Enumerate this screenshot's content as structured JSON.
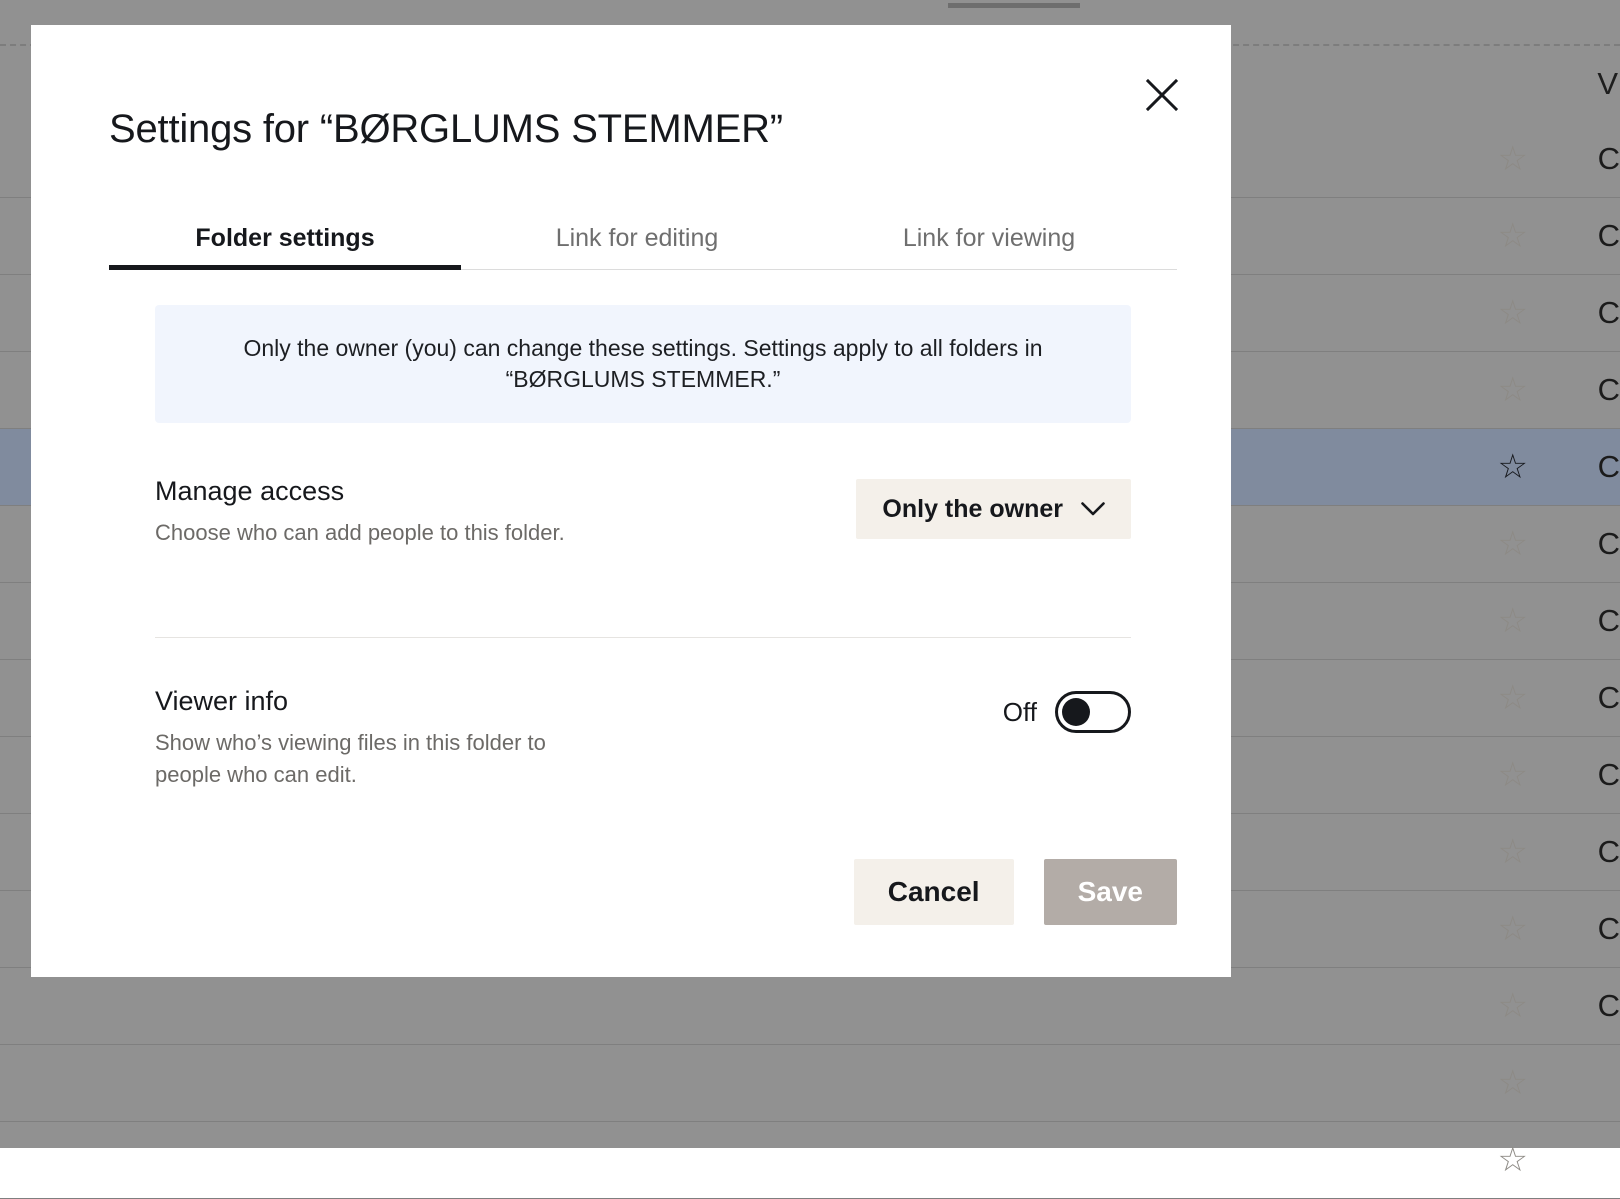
{
  "background": {
    "column_header": "V",
    "rows": [
      {
        "star": "star-outline",
        "text": "C",
        "selected": false
      },
      {
        "star": "star-outline",
        "text": "C",
        "selected": false
      },
      {
        "star": "star-outline",
        "text": "C",
        "selected": false
      },
      {
        "star": "star-outline",
        "text": "C",
        "selected": false
      },
      {
        "star": "star-outline",
        "text": "C",
        "selected": true
      },
      {
        "star": "star-outline",
        "text": "C",
        "selected": false
      },
      {
        "star": "star-outline",
        "text": "C",
        "selected": false
      },
      {
        "star": "star-outline",
        "text": "C",
        "selected": false
      },
      {
        "star": "star-outline",
        "text": "C",
        "selected": false
      },
      {
        "star": "star-outline",
        "text": "C",
        "selected": false
      },
      {
        "star": "star-outline",
        "text": "C",
        "selected": false
      },
      {
        "star": "star-outline",
        "text": "C",
        "selected": false
      },
      {
        "star": "star-outline",
        "text": "",
        "selected": false
      },
      {
        "star": "star-outline",
        "text": "",
        "selected": false
      }
    ],
    "selected_row_color": "#808b9e",
    "overlay_color": "#919191"
  },
  "modal": {
    "title": "Settings for “BØRGLUMS STEMMER”",
    "close_icon": "close-icon",
    "tabs": [
      {
        "label": "Folder settings",
        "active": true
      },
      {
        "label": "Link for editing",
        "active": false
      },
      {
        "label": "Link for viewing",
        "active": false
      }
    ],
    "notice": {
      "text": "Only the owner (you) can change these settings. Settings apply to all folders in “BØRGLUMS STEMMER.”",
      "background": "#f1f5fd"
    },
    "settings": {
      "manage_access": {
        "title": "Manage access",
        "description": "Choose who can add people to this folder.",
        "selected_value": "Only the owner",
        "chevron_icon": "chevron-down-icon",
        "control_background": "#f4f0ea"
      },
      "viewer_info": {
        "title": "Viewer info",
        "description": "Show who’s viewing files in this folder to people who can edit.",
        "toggle_state": "Off",
        "toggle_on": false
      }
    },
    "footer": {
      "cancel_label": "Cancel",
      "save_label": "Save",
      "save_enabled": false,
      "cancel_background": "#f4f0ea",
      "save_background": "#b3aca7"
    }
  }
}
